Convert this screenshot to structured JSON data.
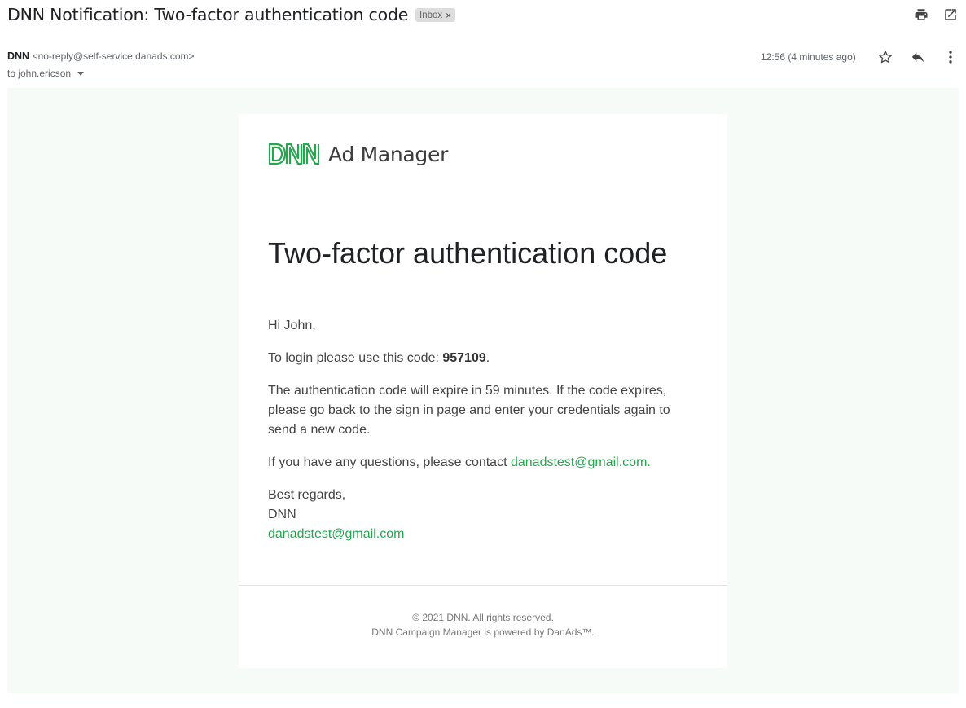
{
  "subject": "DNN Notification: Two-factor authentication code",
  "label": {
    "name": "Inbox",
    "close": "×"
  },
  "toolbar": {
    "print_icon": "print-icon",
    "popout_icon": "open-in-new-window-icon"
  },
  "sender": {
    "name": "DNN",
    "email": "<no-reply@self-service.danads.com>",
    "to": "to john.ericson"
  },
  "timestamp": "12:56 (4 minutes ago)",
  "actions": {
    "star_icon": "star-icon",
    "reply_icon": "reply-icon",
    "more_icon": "more-vertical-icon"
  },
  "email": {
    "logo_text": "Ad Manager",
    "logo_mark": "DNN",
    "heading": "Two-factor authentication code",
    "greeting": "Hi John,",
    "code_prefix": "To login please use this code: ",
    "code": "957109",
    "code_suffix": ".",
    "expire_text": "The authentication code will expire in 59 minutes. If the code expires, please go back to the sign in page and enter your credentials again to send a new code.",
    "questions_prefix": "If you have any questions, please contact ",
    "contact_link": "danadstest@gmail.com.",
    "regards": "Best regards,",
    "signature_name": "DNN",
    "signature_email": "danadstest@gmail.com",
    "footer_line1": "© 2021 DNN. All rights reserved.",
    "footer_line2": "DNN Campaign Manager is powered by DanAds™."
  },
  "colors": {
    "accent_green": "#27a550",
    "email_bg": "#f6fbf7"
  }
}
